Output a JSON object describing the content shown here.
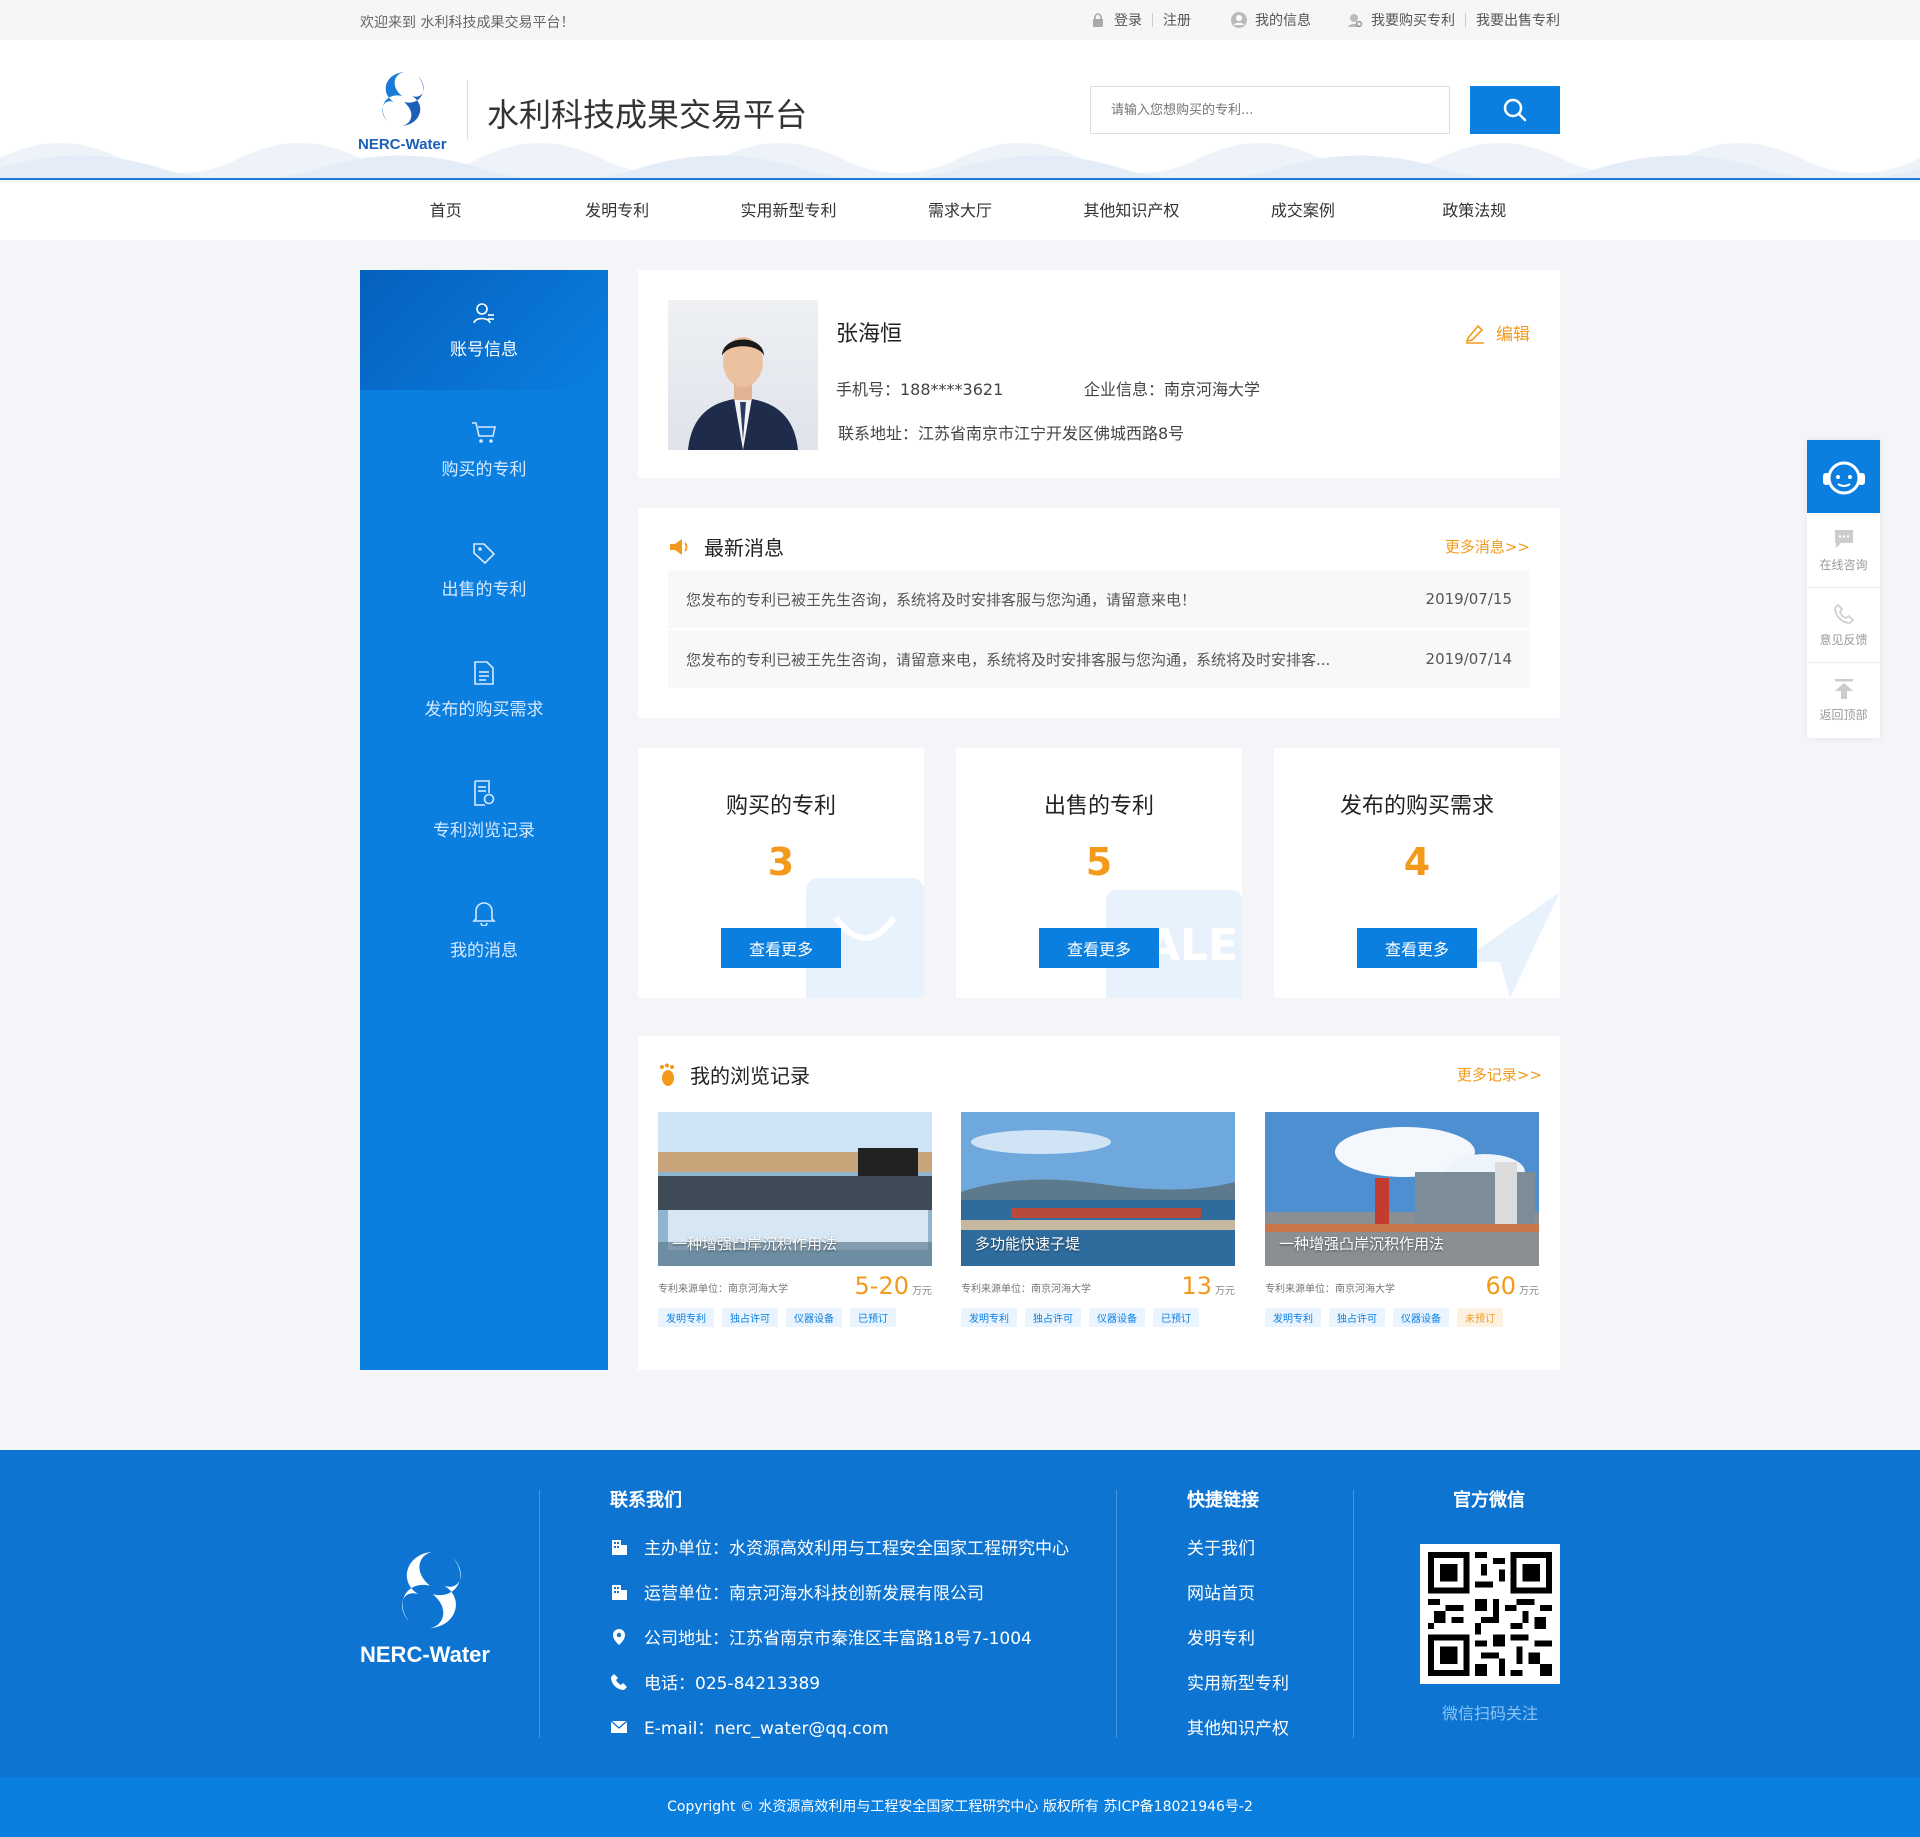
{
  "topbar": {
    "welcome": "欢迎来到  水利科技成果交易平台！",
    "login": "登录",
    "register": "注册",
    "my_info": "我的信息",
    "buy_patent": "我要购买专利",
    "sell_patent": "我要出售专利"
  },
  "header": {
    "logo_text": "NERC-Water",
    "site_title": "水利科技成果交易平台",
    "search_placeholder": "请输入您想购买的专利..."
  },
  "nav": [
    "首页",
    "发明专利",
    "实用新型专利",
    "需求大厅",
    "其他知识产权",
    "成交案例",
    "政策法规"
  ],
  "sidebar": {
    "items": [
      {
        "label": "账号信息",
        "icon": "user-icon"
      },
      {
        "label": "购买的专利",
        "icon": "cart-icon"
      },
      {
        "label": "出售的专利",
        "icon": "tag-icon"
      },
      {
        "label": "发布的购买需求",
        "icon": "document-icon"
      },
      {
        "label": "专利浏览记录",
        "icon": "history-icon"
      },
      {
        "label": "我的消息",
        "icon": "bell-icon"
      }
    ]
  },
  "profile": {
    "name": "张海恒",
    "edit": "编辑",
    "phone": "手机号：188****3621",
    "company": "企业信息：南京河海大学",
    "address": "联系地址：江苏省南京市江宁开发区佛城西路8号"
  },
  "news": {
    "title": "最新消息",
    "more": "更多消息>>",
    "items": [
      {
        "text": "您发布的专利已被王先生咨询，系统将及时安排客服与您沟通，请留意来电！",
        "date": "2019/07/15"
      },
      {
        "text": "您发布的专利已被王先生咨询，请留意来电，系统将及时安排客服与您沟通，系统将及时安排客...",
        "date": "2019/07/14"
      }
    ]
  },
  "stats": [
    {
      "title": "购买的专利",
      "value": "3",
      "button": "查看更多"
    },
    {
      "title": "出售的专利",
      "value": "5",
      "button": "查看更多"
    },
    {
      "title": "发布的购买需求",
      "value": "4",
      "button": "查看更多"
    }
  ],
  "history": {
    "title": "我的浏览记录",
    "more": "更多记录>>",
    "cards": [
      {
        "caption": "一种增强凸岸沉积作用法",
        "source": "专利来源单位：南京河海大学",
        "price": "5-20",
        "unit": "万元",
        "tags": [
          "发明专利",
          "独占许可",
          "仪器设备",
          "已预订"
        ]
      },
      {
        "caption": "多功能快速子堤",
        "source": "专利来源单位：南京河海大学",
        "price": "13",
        "unit": "万元",
        "tags": [
          "发明专利",
          "独占许可",
          "仪器设备",
          "已预订"
        ]
      },
      {
        "caption": "一种增强凸岸沉积作用法",
        "source": "专利来源单位：南京河海大学",
        "price": "60",
        "unit": "万元",
        "tags": [
          "发明专利",
          "独占许可",
          "仪器设备",
          "未预订"
        ]
      }
    ]
  },
  "float": {
    "consult": "在线咨询",
    "feedback": "意见反馈",
    "top": "返回顶部"
  },
  "footer": {
    "logo_text": "NERC-Water",
    "contact_title": "联系我们",
    "host": "主办单位：水资源高效利用与工程安全国家工程研究中心",
    "operator": "运营单位：南京河海水科技创新发展有限公司",
    "address": "公司地址：江苏省南京市秦淮区丰富路18号7-1004",
    "phone": "电话：025-84213389",
    "email": "E-mail：nerc_water@qq.com",
    "links_title": "快捷链接",
    "links": [
      "关于我们",
      "网站首页",
      "发明专利",
      "实用新型专利",
      "其他知识产权"
    ],
    "wechat_title": "官方微信",
    "wechat_caption": "微信扫码关注",
    "copyright": "Copyright © 水资源高效利用与工程安全国家工程研究中心 版权所有     苏ICP备18021946号-2"
  },
  "colors": {
    "primary": "#0b7fe0",
    "accent": "#f39a1a",
    "footer": "#0d74d2"
  }
}
